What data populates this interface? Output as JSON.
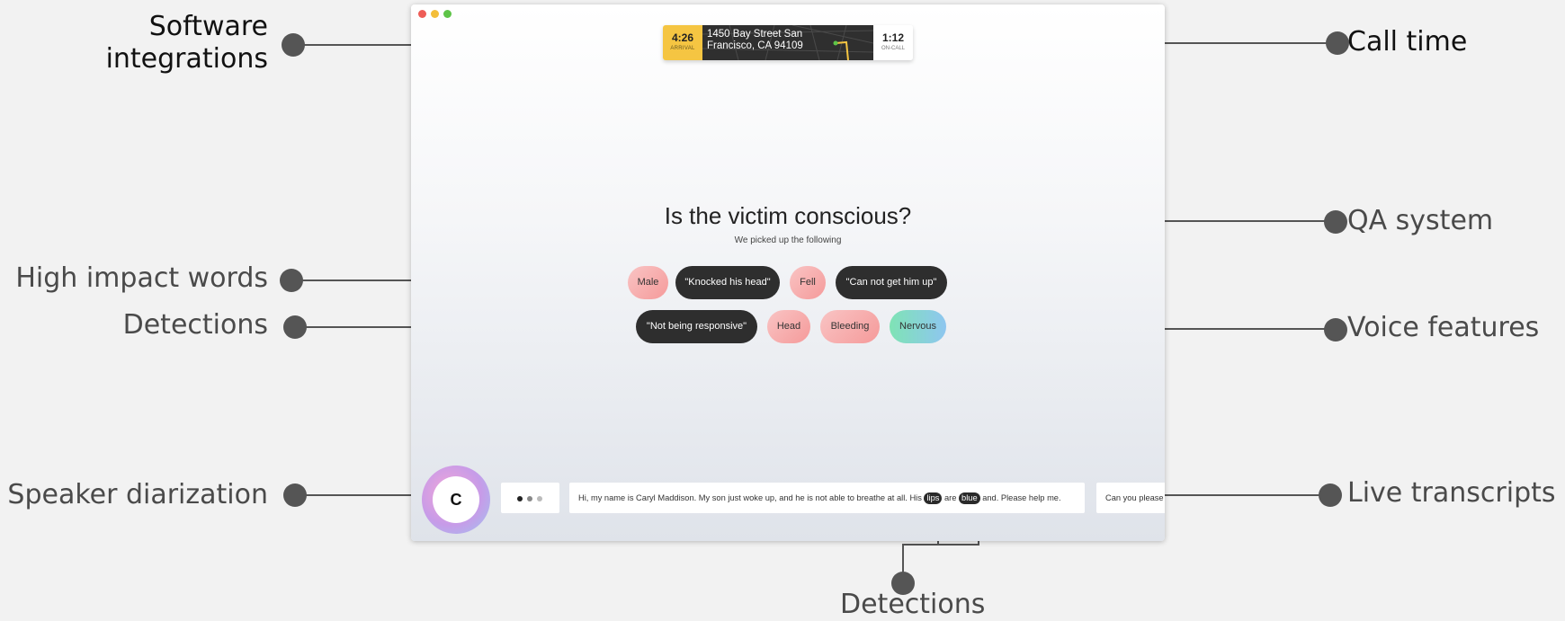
{
  "annotations": {
    "software_integrations": [
      "Software",
      "integrations"
    ],
    "call_time": "Call time",
    "qa_system": "QA system",
    "high_impact_words": "High impact words",
    "detections_left": "Detections",
    "voice_features": "Voice features",
    "speaker_diarization": "Speaker diarization",
    "live_transcripts": "Live transcripts",
    "detections_bottom": "Detections"
  },
  "top_card": {
    "arrival_time": "4:26",
    "arrival_label": "ARRIVAL",
    "address_line1": "1450 Bay Street San",
    "address_line2": "Francisco, CA 94109",
    "oncall_time": "1:12",
    "oncall_label": "ON-CALL"
  },
  "question": "Is the victim conscious?",
  "subtitle": "We picked up the following",
  "detections": {
    "row1": [
      "Male",
      "\"Knocked his head\"",
      "Fell",
      "\"Can not get him up\""
    ],
    "row2": [
      "\"Not being responsive\"",
      "Head",
      "Bleeding",
      "Nervous"
    ]
  },
  "speaker": {
    "initial": "C"
  },
  "transcript": {
    "text_before": "Hi, my name is Caryl Maddison. My son just woke up, and he is not able to breathe at all. His",
    "tag1": "lips",
    "text_mid": "are",
    "tag2": "blue",
    "text_after": "and. Please help me.",
    "next": "Can you please"
  },
  "colors": {
    "arrival_bg": "#f5c542",
    "dark_pill": "#2e2e2e",
    "traffic_red": "#ee5d57",
    "traffic_yellow": "#f3be3a",
    "traffic_green": "#5ec448"
  }
}
